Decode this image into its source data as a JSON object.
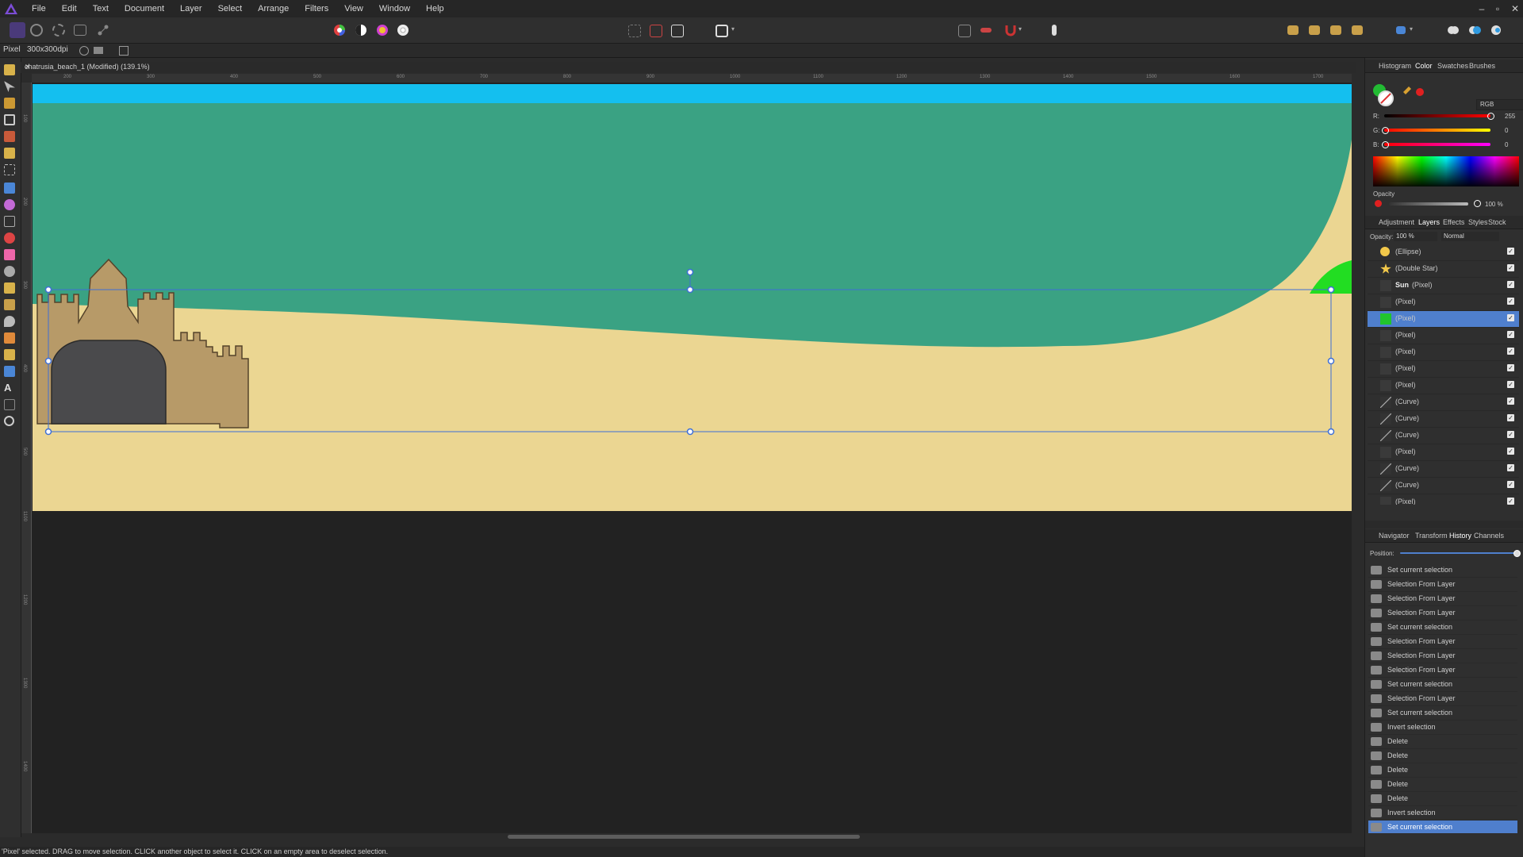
{
  "app": {
    "menu": [
      "File",
      "Edit",
      "Text",
      "Document",
      "Layer",
      "Select",
      "Arrange",
      "Filters",
      "View",
      "Window",
      "Help"
    ],
    "window_controls": [
      "–",
      "▫",
      "✕"
    ]
  },
  "context_bar": {
    "mode": "Pixel",
    "dpi": "300x300dpi"
  },
  "document": {
    "title": "chatrusia_beach_1 (Modified) (139.1%)",
    "close": "✕",
    "ruler_top": [
      "200",
      "300",
      "400",
      "500",
      "600",
      "700",
      "800",
      "900",
      "1000",
      "1100",
      "1200",
      "1300",
      "1400",
      "1500",
      "1600",
      "1700"
    ],
    "ruler_left": [
      "100",
      "200",
      "300",
      "400",
      "500",
      "1100",
      "1200",
      "1300",
      "1400"
    ]
  },
  "status": {
    "text": "'Pixel' selected. DRAG to move selection. CLICK another object to select it. CLICK on an empty area to deselect selection."
  },
  "colors": {
    "sky": "#14bfef",
    "sea": "#3aa283",
    "sand": "#ebd692",
    "castle": "#b79a68",
    "selection": "#3e6fd6",
    "umbrella": "#22dd22"
  },
  "color_panel": {
    "tabs": [
      "Histogram",
      "Color",
      "Swatches",
      "Brushes"
    ],
    "active_tab": "Color",
    "mode": "RGB",
    "r_label": "R:",
    "r_value": "255",
    "g_label": "G:",
    "g_value": "0",
    "b_label": "B:",
    "b_value": "0",
    "opacity_label": "Opacity",
    "opacity_value": "100 %"
  },
  "layers_panel": {
    "tabs": [
      "Adjustment",
      "Layers",
      "Effects",
      "Styles",
      "Stock"
    ],
    "active_tab": "Layers",
    "opacity_label": "Opacity:",
    "opacity_value": "100 %",
    "blend_mode": "Normal",
    "layers": [
      {
        "name": "(Ellipse)",
        "bold": false,
        "selected": false,
        "thumb": "ellipse"
      },
      {
        "name": "(Double Star)",
        "bold": false,
        "selected": false,
        "thumb": "star"
      },
      {
        "name": "Sun",
        "suffix": "(Pixel)",
        "bold": true,
        "selected": false,
        "thumb": "blank"
      },
      {
        "name": "(Pixel)",
        "bold": false,
        "selected": false,
        "thumb": "blank"
      },
      {
        "name": "(Pixel)",
        "bold": false,
        "selected": true,
        "thumb": "green"
      },
      {
        "name": "(Pixel)",
        "bold": false,
        "selected": false,
        "thumb": "blank"
      },
      {
        "name": "(Pixel)",
        "bold": false,
        "selected": false,
        "thumb": "blank"
      },
      {
        "name": "(Pixel)",
        "bold": false,
        "selected": false,
        "thumb": "blank"
      },
      {
        "name": "(Pixel)",
        "bold": false,
        "selected": false,
        "thumb": "blank"
      },
      {
        "name": "(Curve)",
        "bold": false,
        "selected": false,
        "thumb": "curve"
      },
      {
        "name": "(Curve)",
        "bold": false,
        "selected": false,
        "thumb": "curve"
      },
      {
        "name": "(Curve)",
        "bold": false,
        "selected": false,
        "thumb": "curve"
      },
      {
        "name": "(Pixel)",
        "bold": false,
        "selected": false,
        "thumb": "blank"
      },
      {
        "name": "(Curve)",
        "bold": false,
        "selected": false,
        "thumb": "curve"
      },
      {
        "name": "(Curve)",
        "bold": false,
        "selected": false,
        "thumb": "curve"
      },
      {
        "name": "(Pixel)",
        "bold": false,
        "selected": false,
        "thumb": "blank"
      }
    ]
  },
  "history_panel": {
    "tabs": [
      "Navigator",
      "Transform",
      "History",
      "Channels"
    ],
    "active_tab": "History",
    "position_label": "Position:",
    "items": [
      "Set current selection",
      "Selection From Layer",
      "Selection From Layer",
      "Selection From Layer",
      "Set current selection",
      "Selection From Layer",
      "Selection From Layer",
      "Selection From Layer",
      "Set current selection",
      "Selection From Layer",
      "Set current selection",
      "Invert selection",
      "Delete",
      "Delete",
      "Delete",
      "Delete",
      "Delete",
      "Invert selection",
      "Set current selection"
    ],
    "selected_index": 18
  }
}
